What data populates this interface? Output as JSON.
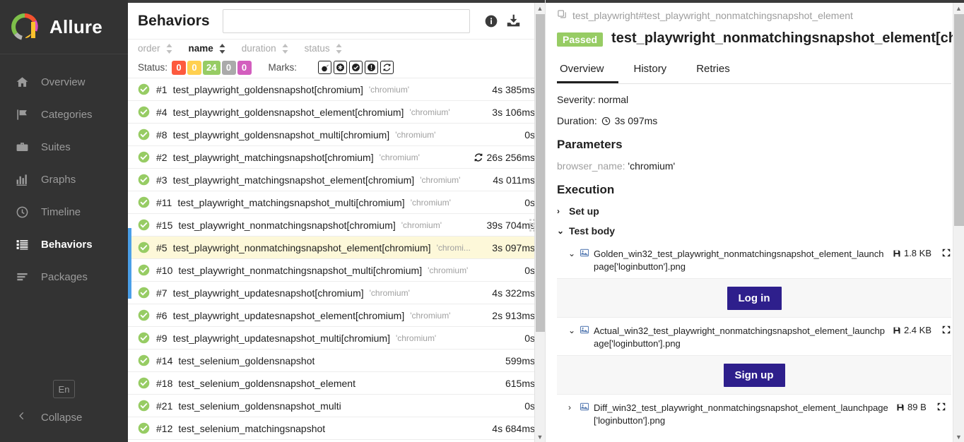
{
  "sidebar": {
    "brand": "Allure",
    "items": [
      {
        "label": "Overview",
        "icon": "home-icon"
      },
      {
        "label": "Categories",
        "icon": "flag-icon"
      },
      {
        "label": "Suites",
        "icon": "briefcase-icon"
      },
      {
        "label": "Graphs",
        "icon": "bar-chart-icon"
      },
      {
        "label": "Timeline",
        "icon": "clock-icon"
      },
      {
        "label": "Behaviors",
        "icon": "list-icon"
      },
      {
        "label": "Packages",
        "icon": "layers-icon"
      }
    ],
    "active_item": "Behaviors",
    "language": "En",
    "collapse": "Collapse"
  },
  "list_panel": {
    "title": "Behaviors",
    "search_value": "",
    "search_placeholder": "",
    "info_icon": "info-icon",
    "download_icon": "download-icon",
    "sort_columns": [
      {
        "label": "order",
        "active": false
      },
      {
        "label": "name",
        "active": true
      },
      {
        "label": "duration",
        "active": false
      },
      {
        "label": "status",
        "active": false
      }
    ],
    "status_label": "Status:",
    "status_chips": [
      {
        "value": "0",
        "color": "#fd5a3e",
        "name": "failed"
      },
      {
        "value": "0",
        "color": "#ffd050",
        "name": "broken"
      },
      {
        "value": "24",
        "color": "#97cc64",
        "name": "passed"
      },
      {
        "value": "0",
        "color": "#aaaaaa",
        "name": "skipped"
      },
      {
        "value": "0",
        "color": "#d35ebe",
        "name": "unknown"
      }
    ],
    "marks_label": "Marks:",
    "marks": [
      "bomb-icon",
      "gear-asterisk-icon",
      "check-circle-icon",
      "exclamation-circle-icon",
      "retry-icon"
    ],
    "rows": [
      {
        "order": "#1",
        "name": "test_playwright_goldensnapshot[chromium]",
        "param": "'chromium'",
        "duration": "4s 385ms",
        "status": "passed",
        "retry": false,
        "selected": false
      },
      {
        "order": "#4",
        "name": "test_playwright_goldensnapshot_element[chromium]",
        "param": "'chromium'",
        "duration": "3s 106ms",
        "status": "passed",
        "retry": false,
        "selected": false
      },
      {
        "order": "#8",
        "name": "test_playwright_goldensnapshot_multi[chromium]",
        "param": "'chromium'",
        "duration": "0s",
        "status": "passed",
        "retry": false,
        "selected": false
      },
      {
        "order": "#2",
        "name": "test_playwright_matchingsnapshot[chromium]",
        "param": "'chromium'",
        "duration": "26s 256ms",
        "status": "passed",
        "retry": true,
        "selected": false
      },
      {
        "order": "#3",
        "name": "test_playwright_matchingsnapshot_element[chromium]",
        "param": "'chromium'",
        "duration": "4s 011ms",
        "status": "passed",
        "retry": false,
        "selected": false
      },
      {
        "order": "#11",
        "name": "test_playwright_matchingsnapshot_multi[chromium]",
        "param": "'chromium'",
        "duration": "0s",
        "status": "passed",
        "retry": false,
        "selected": false
      },
      {
        "order": "#15",
        "name": "test_playwright_nonmatchingsnapshot[chromium]",
        "param": "'chromium'",
        "duration": "39s 704ms",
        "status": "passed",
        "retry": false,
        "selected": false
      },
      {
        "order": "#5",
        "name": "test_playwright_nonmatchingsnapshot_element[chromium]",
        "param": "'chromi...",
        "duration": "3s 097ms",
        "status": "passed",
        "retry": false,
        "selected": true
      },
      {
        "order": "#10",
        "name": "test_playwright_nonmatchingsnapshot_multi[chromium]",
        "param": "'chromium'",
        "duration": "0s",
        "status": "passed",
        "retry": false,
        "selected": false
      },
      {
        "order": "#7",
        "name": "test_playwright_updatesnapshot[chromium]",
        "param": "'chromium'",
        "duration": "4s 322ms",
        "status": "passed",
        "retry": false,
        "selected": false
      },
      {
        "order": "#6",
        "name": "test_playwright_updatesnapshot_element[chromium]",
        "param": "'chromium'",
        "duration": "2s 913ms",
        "status": "passed",
        "retry": false,
        "selected": false
      },
      {
        "order": "#9",
        "name": "test_playwright_updatesnapshot_multi[chromium]",
        "param": "'chromium'",
        "duration": "0s",
        "status": "passed",
        "retry": false,
        "selected": false
      },
      {
        "order": "#14",
        "name": "test_selenium_goldensnapshot",
        "param": "",
        "duration": "599ms",
        "status": "passed",
        "retry": false,
        "selected": false
      },
      {
        "order": "#18",
        "name": "test_selenium_goldensnapshot_element",
        "param": "",
        "duration": "615ms",
        "status": "passed",
        "retry": false,
        "selected": false
      },
      {
        "order": "#21",
        "name": "test_selenium_goldensnapshot_multi",
        "param": "",
        "duration": "0s",
        "status": "passed",
        "retry": false,
        "selected": false
      },
      {
        "order": "#12",
        "name": "test_selenium_matchingsnapshot",
        "param": "",
        "duration": "4s 684ms",
        "status": "passed",
        "retry": false,
        "selected": false
      }
    ]
  },
  "detail": {
    "breadcrumb": "test_playwright#test_playwright_nonmatchingsnapshot_element",
    "status_badge": "Passed",
    "title": "test_playwright_nonmatchingsnapshot_element[chromium]",
    "tabs": [
      {
        "label": "Overview",
        "active": true
      },
      {
        "label": "History",
        "active": false
      },
      {
        "label": "Retries",
        "active": false
      }
    ],
    "severity": "Severity: normal",
    "duration_label": "Duration:",
    "duration_value": "3s 097ms",
    "parameters_heading": "Parameters",
    "parameter_key": "browser_name:",
    "parameter_value": "'chromium'",
    "execution_heading": "Execution",
    "steps": [
      {
        "label": "Set up",
        "expanded": false
      },
      {
        "label": "Test body",
        "expanded": true
      }
    ],
    "attachments": [
      {
        "name": "Golden_win32_test_playwright_nonmatchingsnapshot_element_launchpage['loginbutton'].png",
        "size": "1.8 KB",
        "expanded": true,
        "preview_button": "Log in",
        "preview_color": "#2e1f8c"
      },
      {
        "name": "Actual_win32_test_playwright_nonmatchingsnapshot_element_launchpage['loginbutton'].png",
        "size": "2.4 KB",
        "expanded": true,
        "preview_button": "Sign up",
        "preview_color": "#2e1f8c"
      },
      {
        "name": "Diff_win32_test_playwright_nonmatchingsnapshot_element_launchpage['loginbutton'].png",
        "size": "89 B",
        "expanded": false,
        "preview_button": "",
        "preview_color": ""
      }
    ]
  },
  "colors": {
    "sidebar_bg": "#333333",
    "passed_green": "#97cc64",
    "accent_blue": "#4a9fe8",
    "selected_row": "#fdf8d9",
    "brand_purple": "#2e1f8c"
  }
}
